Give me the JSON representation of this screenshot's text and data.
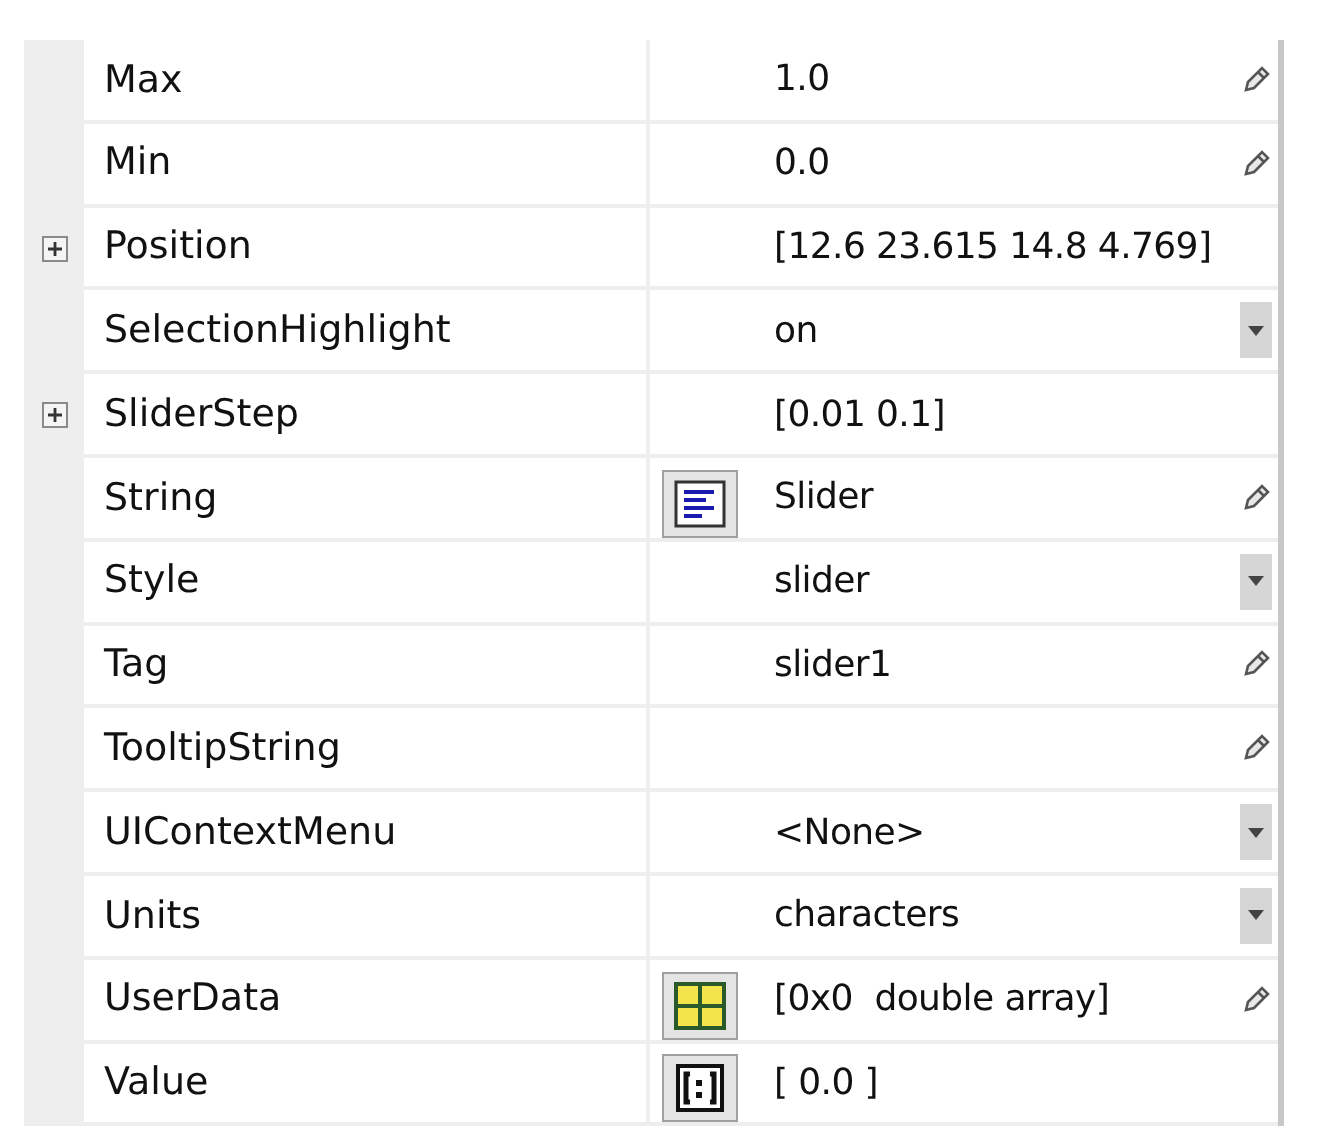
{
  "properties": [
    {
      "name": "Max",
      "kind": "plain",
      "expandable": false,
      "value": "1.0",
      "editable": true,
      "dropdown": false
    },
    {
      "name": "Min",
      "kind": "plain",
      "expandable": false,
      "value": "0.0",
      "editable": true,
      "dropdown": false
    },
    {
      "name": "Position",
      "kind": "plain",
      "expandable": true,
      "value": "[12.6 23.615 14.8 4.769]",
      "editable": false,
      "dropdown": false
    },
    {
      "name": "SelectionHighlight",
      "kind": "plain",
      "expandable": false,
      "value": "on",
      "editable": false,
      "dropdown": true
    },
    {
      "name": "SliderStep",
      "kind": "plain",
      "expandable": true,
      "value": "[0.01 0.1]",
      "editable": false,
      "dropdown": false
    },
    {
      "name": "String",
      "kind": "text",
      "expandable": false,
      "value": "Slider",
      "editable": true,
      "dropdown": false
    },
    {
      "name": "Style",
      "kind": "plain",
      "expandable": false,
      "value": "slider",
      "editable": false,
      "dropdown": true
    },
    {
      "name": "Tag",
      "kind": "plain",
      "expandable": false,
      "value": "slider1",
      "editable": true,
      "dropdown": false
    },
    {
      "name": "TooltipString",
      "kind": "plain",
      "expandable": false,
      "editable": true,
      "dropdown": false
    },
    {
      "name": "UIContextMenu",
      "kind": "plain",
      "expandable": false,
      "value": "<None>",
      "editable": false,
      "dropdown": true
    },
    {
      "name": "Units",
      "kind": "plain",
      "expandable": false,
      "value": "characters",
      "editable": false,
      "dropdown": true
    },
    {
      "name": "UserData",
      "kind": "table",
      "expandable": false,
      "value": "[0x0  double array]",
      "editable": true,
      "dropdown": false
    },
    {
      "name": "Value",
      "kind": "array",
      "expandable": false,
      "value": "[ 0.0 ]",
      "editable": false,
      "dropdown": false
    }
  ]
}
